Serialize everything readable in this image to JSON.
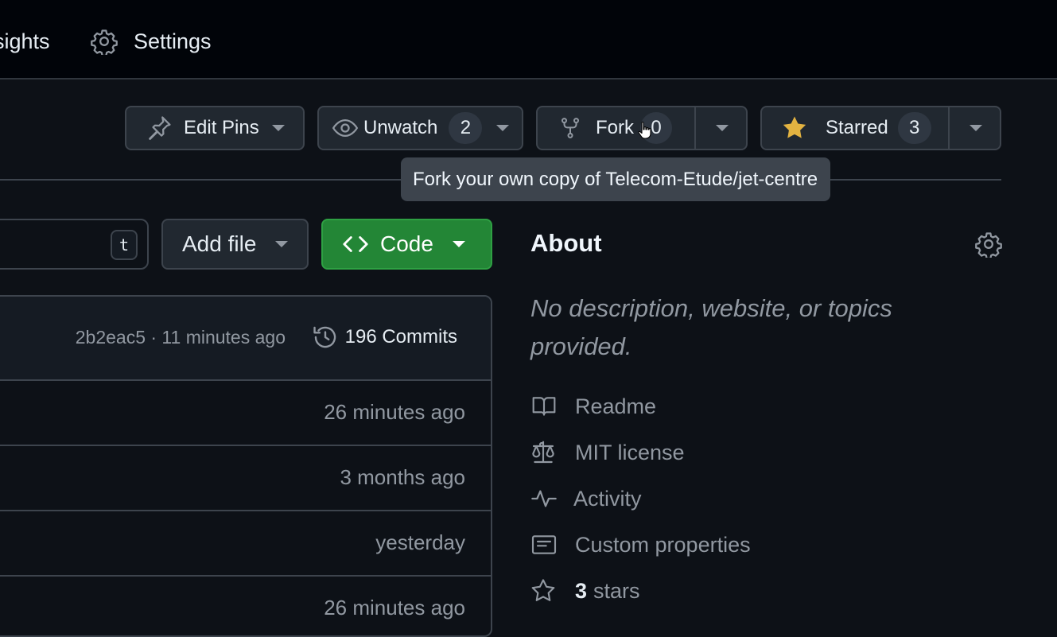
{
  "topnav": {
    "insights_label": "sights",
    "settings_label": "Settings"
  },
  "actions": {
    "edit_pins_label": "Edit Pins",
    "unwatch_label": "Unwatch",
    "unwatch_count": "2",
    "fork_label": "Fork",
    "fork_count": "0",
    "starred_label": "Starred",
    "starred_count": "3",
    "star_color": "#e3b341"
  },
  "tooltip": "Fork your own copy of Telecom-Etude/jet-centre",
  "toolbar": {
    "search_shortcut": "t",
    "add_file_label": "Add file",
    "code_label": "Code",
    "code_color": "#238636"
  },
  "latest_commit": {
    "meta": "2b2eac5 · 11 minutes ago",
    "commits_label": "196 Commits"
  },
  "files": [
    {
      "time": "26 minutes ago"
    },
    {
      "time": "3 months ago"
    },
    {
      "time": "yesterday"
    },
    {
      "time": "26 minutes ago"
    }
  ],
  "about": {
    "title": "About",
    "description": "No description, website, or topics provided.",
    "items": [
      {
        "icon": "book-icon",
        "label": "Readme"
      },
      {
        "icon": "scale-icon",
        "label": "MIT license"
      },
      {
        "icon": "pulse-icon",
        "label": "Activity"
      },
      {
        "icon": "note-icon",
        "label": "Custom properties"
      }
    ],
    "stars_count": "3",
    "stars_label": "stars"
  }
}
